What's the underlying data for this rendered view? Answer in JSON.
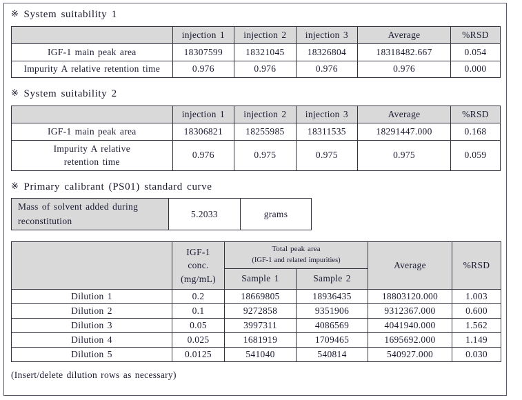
{
  "document": {
    "mark_glyph": "※",
    "footnote": "(Insert/delete dilution rows as necessary)"
  },
  "section1": {
    "heading": "System suitability 1",
    "table": {
      "columns": [
        "",
        "injection 1",
        "injection 2",
        "injection 3",
        "Average",
        "%RSD"
      ],
      "rows": [
        {
          "label": "IGF-1 main peak area",
          "values": [
            "18307599",
            "18321045",
            "18326804",
            "18318482.667",
            "0.054"
          ]
        },
        {
          "label": "Impurity A relative retention time",
          "values": [
            "0.976",
            "0.976",
            "0.976",
            "0.976",
            "0.000"
          ]
        }
      ]
    }
  },
  "section2": {
    "heading": "System suitability 2",
    "table": {
      "columns": [
        "",
        "injection 1",
        "injection 2",
        "injection 3",
        "Average",
        "%RSD"
      ],
      "rows": [
        {
          "label": "IGF-1 main peak area",
          "values": [
            "18306821",
            "18255985",
            "18311535",
            "18291447.000",
            "0.168"
          ]
        },
        {
          "label_line1": "Impurity A relative",
          "label_line2": "retention time",
          "values": [
            "0.976",
            "0.975",
            "0.975",
            "0.975",
            "0.059"
          ]
        }
      ]
    }
  },
  "section3": {
    "heading": "Primary calibrant (PS01) standard curve",
    "solvent_table": {
      "label_line1": "Mass of solvent added during",
      "label_line2": "reconstitution",
      "value": "5.2033",
      "unit": "grams"
    },
    "dilution_table": {
      "header": {
        "col0": "",
        "conc_line1": "IGF-1",
        "conc_line2": "conc.",
        "conc_line3": "(mg/mL)",
        "peak_group_line1": "Total peak area",
        "peak_group_line2": "(IGF-1 and related impurities)",
        "sample1": "Sample 1",
        "sample2": "Sample 2",
        "average": "Average",
        "rsd": "%RSD"
      },
      "rows": [
        {
          "label": "Dilution 1",
          "conc": "0.2",
          "sample1": "18669805",
          "sample2": "18936435",
          "average": "18803120.000",
          "rsd": "1.003"
        },
        {
          "label": "Dilution 2",
          "conc": "0.1",
          "sample1": "9272858",
          "sample2": "9351906",
          "average": "9312367.000",
          "rsd": "0.600"
        },
        {
          "label": "Dilution 3",
          "conc": "0.05",
          "sample1": "3997311",
          "sample2": "4086569",
          "average": "4041940.000",
          "rsd": "1.562"
        },
        {
          "label": "Dilution 4",
          "conc": "0.025",
          "sample1": "1681919",
          "sample2": "1709465",
          "average": "1695692.000",
          "rsd": "1.149"
        },
        {
          "label": "Dilution 5",
          "conc": "0.0125",
          "sample1": "541040",
          "sample2": "540814",
          "average": "540927.000",
          "rsd": "0.030"
        }
      ]
    }
  },
  "colors": {
    "header_fill": "#d9d9d9",
    "border": "#333340",
    "text": "#1b1b33"
  }
}
